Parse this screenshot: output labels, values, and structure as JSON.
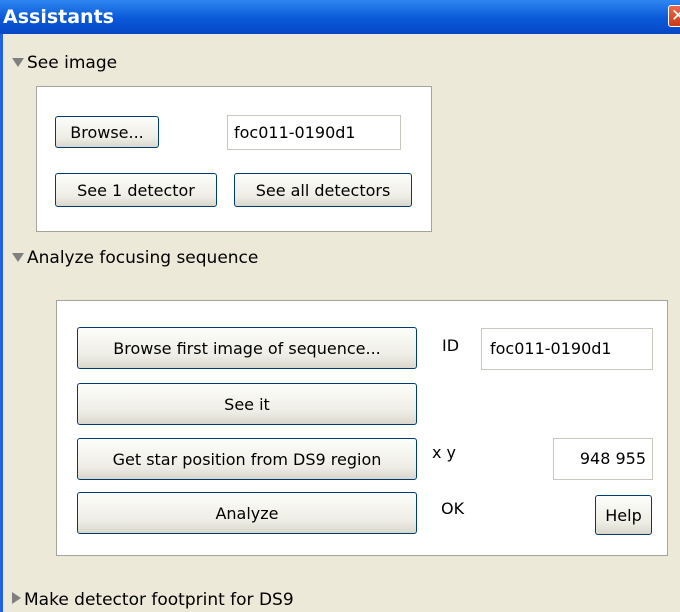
{
  "window": {
    "title": "Assistants",
    "close_glyph": "✕"
  },
  "see_image": {
    "header": "See image",
    "browse_label": "Browse...",
    "image_id_value": "foc011-0190d1",
    "see_one_label": "See 1 detector",
    "see_all_label": "See all detectors"
  },
  "analyze": {
    "header": "Analyze focusing sequence",
    "browse_first_label": "Browse first image of sequence...",
    "id_label": "ID",
    "id_value": "foc011-0190d1",
    "see_it_label": "See it",
    "get_star_label": "Get star position from DS9 region",
    "xy_label": "x y",
    "xy_value": "948 955",
    "analyze_label": "Analyze",
    "status": "OK",
    "help_label": "Help"
  },
  "footprint": {
    "header": "Make detector footprint for DS9"
  },
  "icons": {
    "expanded": "triangle-down-icon",
    "collapsed": "triangle-right-icon",
    "close": "close-icon"
  },
  "colors": {
    "titlebar": "#0a58d8",
    "background": "#ece9d8",
    "button_border": "#003c74",
    "close_button": "#c83c1a"
  }
}
